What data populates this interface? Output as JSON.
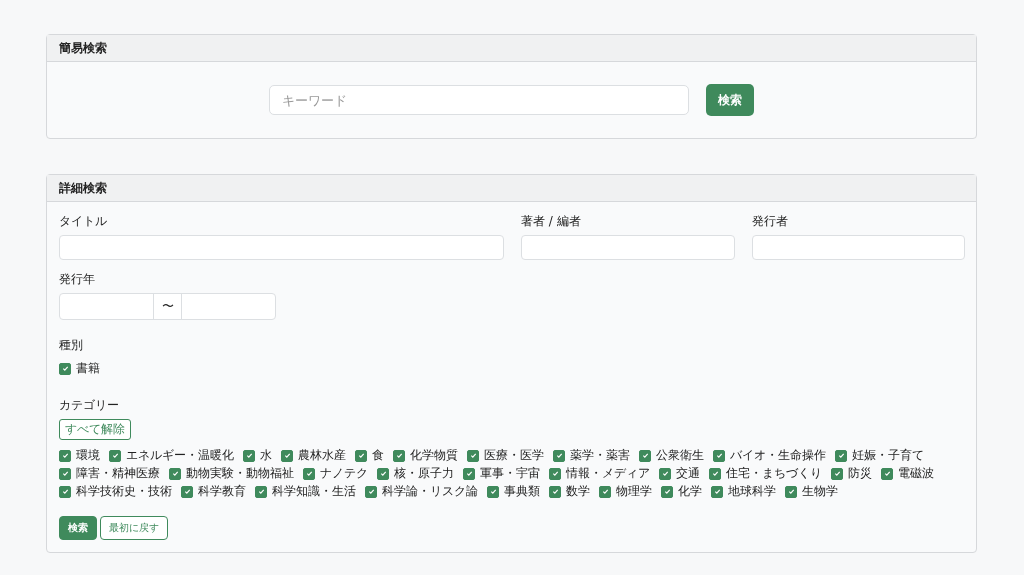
{
  "simple_search": {
    "title": "簡易検索",
    "keyword": {
      "placeholder": "キーワード"
    },
    "button": "検索"
  },
  "detail_search": {
    "title": "詳細検索",
    "fields": [
      {
        "label": "タイトル"
      },
      {
        "label": "著者 / 編者"
      },
      {
        "label": "発行者"
      }
    ],
    "year": {
      "label": "発行年",
      "separator": "〜"
    },
    "type": {
      "label": "種別",
      "options": [
        {
          "label": "書籍",
          "checked": true
        }
      ]
    },
    "category": {
      "label": "カテゴリー",
      "clear_button": "すべて解除",
      "options": [
        {
          "label": "環境",
          "checked": true
        },
        {
          "label": "エネルギー・温暖化",
          "checked": true
        },
        {
          "label": "水",
          "checked": true
        },
        {
          "label": "農林水産",
          "checked": true
        },
        {
          "label": "食",
          "checked": true
        },
        {
          "label": "化学物質",
          "checked": true
        },
        {
          "label": "医療・医学",
          "checked": true
        },
        {
          "label": "薬学・薬害",
          "checked": true
        },
        {
          "label": "公衆衛生",
          "checked": true
        },
        {
          "label": "バイオ・生命操作",
          "checked": true
        },
        {
          "label": "妊娠・子育て",
          "checked": true
        },
        {
          "label": "障害・精神医療",
          "checked": true
        },
        {
          "label": "動物実験・動物福祉",
          "checked": true
        },
        {
          "label": "ナノテク",
          "checked": true
        },
        {
          "label": "核・原子力",
          "checked": true
        },
        {
          "label": "軍事・宇宙",
          "checked": true
        },
        {
          "label": "情報・メディア",
          "checked": true
        },
        {
          "label": "交通",
          "checked": true
        },
        {
          "label": "住宅・まちづくり",
          "checked": true
        },
        {
          "label": "防災",
          "checked": true
        },
        {
          "label": "電磁波",
          "checked": true
        },
        {
          "label": "科学技術史・技術",
          "checked": true
        },
        {
          "label": "科学教育",
          "checked": true
        },
        {
          "label": "科学知識・生活",
          "checked": true
        },
        {
          "label": "科学論・リスク論",
          "checked": true
        },
        {
          "label": "事典類",
          "checked": true
        },
        {
          "label": "数学",
          "checked": true
        },
        {
          "label": "物理学",
          "checked": true
        },
        {
          "label": "化学",
          "checked": true
        },
        {
          "label": "地球科学",
          "checked": true
        },
        {
          "label": "生物学",
          "checked": true
        }
      ]
    },
    "buttons": [
      {
        "label": "検索",
        "kind": "primary"
      },
      {
        "label": "最初に戻す",
        "kind": "outline"
      }
    ]
  }
}
